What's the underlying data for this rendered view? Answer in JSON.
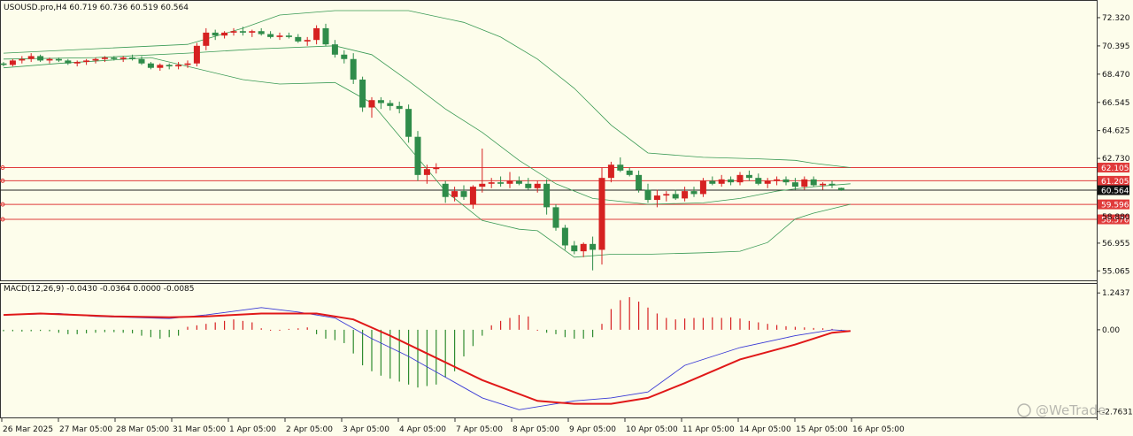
{
  "header": {
    "symbol_info": "USOUSD.pro,H4  60.719 60.736 60.519 60.564",
    "indicator_info": "MACD(12,26,9) -0.0430 -0.0364 0.0000 -0.0085"
  },
  "watermark": "@WeTrade",
  "colors": {
    "background": "#fdfdeb",
    "bull": "#d62121",
    "bear": "#2f8c4a",
    "bands": "#3a9a55",
    "hline": "#e03a3a",
    "signal": "#e01818",
    "macd_line": "#3a3ad6",
    "hist_up": "#d62121",
    "hist_down": "#2f8c2f"
  },
  "price_axis_labels": [
    "72.320",
    "70.395",
    "68.470",
    "66.545",
    "64.625",
    "62.730",
    "61.205",
    "59.596",
    "58.576",
    "56.955",
    "55.065"
  ],
  "macd_axis_labels": [
    "1.2437",
    "0.00",
    "-2.7631"
  ],
  "markers": [
    {
      "label": "62.105",
      "value": 62.105,
      "style": "red"
    },
    {
      "label": "61.205",
      "value": 61.205,
      "style": "red"
    },
    {
      "label": "60.564",
      "value": 60.564,
      "style": "current"
    },
    {
      "label": "59.596",
      "value": 59.596,
      "style": "red"
    },
    {
      "label": "58.576",
      "value": 58.576,
      "style": "red"
    },
    {
      "label": "58.880",
      "value": 58.88,
      "style": "plain"
    }
  ],
  "time_labels": [
    "26 Mar 2025",
    "27 Mar 05:00",
    "28 Mar 05:00",
    "31 Mar 05:00",
    "1 Apr 05:00",
    "2 Apr 05:00",
    "3 Apr 05:00",
    "4 Apr 05:00",
    "7 Apr 05:00",
    "8 Apr 05:00",
    "9 Apr 05:00",
    "10 Apr 05:00",
    "11 Apr 05:00",
    "14 Apr 05:00",
    "15 Apr 05:00",
    "16 Apr 05:00"
  ],
  "chart_data": {
    "type": "candlestick",
    "symbol": "USOUSD.pro",
    "timeframe": "H4",
    "ylim": [
      54.6,
      72.8
    ],
    "macd_ylim": [
      -2.9,
      1.4
    ],
    "candles": [
      [
        69.2,
        69.3,
        69.0,
        69.1
      ],
      [
        69.1,
        69.5,
        69.0,
        69.4
      ],
      [
        69.4,
        69.7,
        69.2,
        69.5
      ],
      [
        69.5,
        69.9,
        69.3,
        69.7
      ],
      [
        69.7,
        69.8,
        69.3,
        69.4
      ],
      [
        69.4,
        69.6,
        69.2,
        69.5
      ],
      [
        69.5,
        69.6,
        69.3,
        69.4
      ],
      [
        69.4,
        69.5,
        69.1,
        69.2
      ],
      [
        69.2,
        69.4,
        69.0,
        69.3
      ],
      [
        69.3,
        69.5,
        69.1,
        69.4
      ],
      [
        69.4,
        69.6,
        69.2,
        69.5
      ],
      [
        69.5,
        69.7,
        69.3,
        69.6
      ],
      [
        69.6,
        69.7,
        69.4,
        69.5
      ],
      [
        69.5,
        69.7,
        69.3,
        69.6
      ],
      [
        69.6,
        69.8,
        69.4,
        69.5
      ],
      [
        69.5,
        69.7,
        69.1,
        69.2
      ],
      [
        69.2,
        69.3,
        68.8,
        68.9
      ],
      [
        68.9,
        69.2,
        68.7,
        69.1
      ],
      [
        69.1,
        69.2,
        68.8,
        69.0
      ],
      [
        69.0,
        69.3,
        68.8,
        69.1
      ],
      [
        69.1,
        69.4,
        68.9,
        69.2
      ],
      [
        69.2,
        70.6,
        69.0,
        70.4
      ],
      [
        70.4,
        71.6,
        70.1,
        71.3
      ],
      [
        71.3,
        71.5,
        70.8,
        71.1
      ],
      [
        71.1,
        71.4,
        70.9,
        71.3
      ],
      [
        71.3,
        71.6,
        71.1,
        71.4
      ],
      [
        71.4,
        71.7,
        71.1,
        71.3
      ],
      [
        71.3,
        71.5,
        71.0,
        71.4
      ],
      [
        71.4,
        71.6,
        71.1,
        71.2
      ],
      [
        71.2,
        71.4,
        70.9,
        71.0
      ],
      [
        71.0,
        71.3,
        70.8,
        71.1
      ],
      [
        71.1,
        71.3,
        70.9,
        71.0
      ],
      [
        71.0,
        71.2,
        70.6,
        70.7
      ],
      [
        70.7,
        71.0,
        70.4,
        70.8
      ],
      [
        70.8,
        71.8,
        70.5,
        71.6
      ],
      [
        71.6,
        71.9,
        70.4,
        70.5
      ],
      [
        70.5,
        70.8,
        69.6,
        69.8
      ],
      [
        69.8,
        70.1,
        69.2,
        69.5
      ],
      [
        69.5,
        69.9,
        67.8,
        68.1
      ],
      [
        68.1,
        68.3,
        65.9,
        66.2
      ],
      [
        66.2,
        66.9,
        65.5,
        66.7
      ],
      [
        66.7,
        66.9,
        66.1,
        66.5
      ],
      [
        66.5,
        66.7,
        66.0,
        66.3
      ],
      [
        66.3,
        66.6,
        65.8,
        66.1
      ],
      [
        66.1,
        66.4,
        63.8,
        64.2
      ],
      [
        64.2,
        64.6,
        61.2,
        61.6
      ],
      [
        61.6,
        62.3,
        61.0,
        62.0
      ],
      [
        62.0,
        62.4,
        61.7,
        62.1
      ],
      [
        61.0,
        61.2,
        59.7,
        60.1
      ],
      [
        60.1,
        60.8,
        59.8,
        60.5
      ],
      [
        60.5,
        60.9,
        59.9,
        60.1
      ],
      [
        59.6,
        60.9,
        59.3,
        60.8
      ],
      [
        60.8,
        63.4,
        60.4,
        61.0
      ],
      [
        61.0,
        61.4,
        60.7,
        61.1
      ],
      [
        61.1,
        61.5,
        60.8,
        61.0
      ],
      [
        61.0,
        61.8,
        60.7,
        61.2
      ],
      [
        61.2,
        61.5,
        60.9,
        61.0
      ],
      [
        61.0,
        61.4,
        60.6,
        60.7
      ],
      [
        60.7,
        61.2,
        60.4,
        61.0
      ],
      [
        61.0,
        61.3,
        58.9,
        59.4
      ],
      [
        59.4,
        59.6,
        57.8,
        58.0
      ],
      [
        58.0,
        58.2,
        56.5,
        56.8
      ],
      [
        56.8,
        57.1,
        56.2,
        56.4
      ],
      [
        56.4,
        57.0,
        56.0,
        56.9
      ],
      [
        56.9,
        57.4,
        55.1,
        56.5
      ],
      [
        56.5,
        62.1,
        55.5,
        61.4
      ],
      [
        61.4,
        62.5,
        61.1,
        62.3
      ],
      [
        62.3,
        62.8,
        61.8,
        61.9
      ],
      [
        61.9,
        62.1,
        61.5,
        61.6
      ],
      [
        61.6,
        61.9,
        60.4,
        60.6
      ],
      [
        60.6,
        61.0,
        59.7,
        59.9
      ],
      [
        59.9,
        60.6,
        59.4,
        60.2
      ],
      [
        60.2,
        60.5,
        59.8,
        60.3
      ],
      [
        60.3,
        60.6,
        59.9,
        60.0
      ],
      [
        60.0,
        60.8,
        59.8,
        60.5
      ],
      [
        60.5,
        60.8,
        60.1,
        60.3
      ],
      [
        60.3,
        61.4,
        60.1,
        61.2
      ],
      [
        61.2,
        61.5,
        60.9,
        61.0
      ],
      [
        61.0,
        61.6,
        60.8,
        61.3
      ],
      [
        61.3,
        61.5,
        60.9,
        61.1
      ],
      [
        61.1,
        61.8,
        60.9,
        61.6
      ],
      [
        61.6,
        61.9,
        61.2,
        61.4
      ],
      [
        61.4,
        61.7,
        60.9,
        61.0
      ],
      [
        61.0,
        61.4,
        60.7,
        61.2
      ],
      [
        61.2,
        61.5,
        60.9,
        61.3
      ],
      [
        61.3,
        61.5,
        60.9,
        61.1
      ],
      [
        61.1,
        61.4,
        60.6,
        60.8
      ],
      [
        60.8,
        61.5,
        60.6,
        61.3
      ],
      [
        61.3,
        61.5,
        60.8,
        60.9
      ],
      [
        60.9,
        61.1,
        60.6,
        61.0
      ],
      [
        61.0,
        61.2,
        60.7,
        60.9
      ],
      [
        60.719,
        60.736,
        60.519,
        60.564
      ]
    ],
    "upper_band": [
      [
        0,
        69.9
      ],
      [
        10,
        70.2
      ],
      [
        20,
        70.5
      ],
      [
        26,
        71.6
      ],
      [
        30,
        72.5
      ],
      [
        36,
        72.8
      ],
      [
        44,
        72.8
      ],
      [
        50,
        72.0
      ],
      [
        54,
        71.0
      ],
      [
        58,
        69.5
      ],
      [
        62,
        67.5
      ],
      [
        66,
        65.0
      ],
      [
        70,
        63.1
      ],
      [
        76,
        62.8
      ],
      [
        82,
        62.7
      ],
      [
        86,
        62.6
      ],
      [
        88,
        62.4
      ],
      [
        92,
        62.1
      ]
    ],
    "middle_band": [
      [
        0,
        69.5
      ],
      [
        10,
        69.6
      ],
      [
        20,
        69.9
      ],
      [
        28,
        70.2
      ],
      [
        36,
        70.4
      ],
      [
        40,
        69.8
      ],
      [
        44,
        68.0
      ],
      [
        48,
        66.1
      ],
      [
        52,
        64.5
      ],
      [
        56,
        62.6
      ],
      [
        60,
        61.0
      ],
      [
        64,
        60.0
      ],
      [
        70,
        59.6
      ],
      [
        76,
        59.7
      ],
      [
        80,
        60.0
      ],
      [
        84,
        60.5
      ],
      [
        88,
        60.8
      ],
      [
        92,
        61.0
      ]
    ],
    "lower_band": [
      [
        0,
        68.9
      ],
      [
        6,
        69.2
      ],
      [
        16,
        69.6
      ],
      [
        26,
        68.1
      ],
      [
        30,
        67.8
      ],
      [
        36,
        67.9
      ],
      [
        40,
        66.5
      ],
      [
        44,
        63.5
      ],
      [
        48,
        60.5
      ],
      [
        52,
        58.5
      ],
      [
        56,
        57.9
      ],
      [
        58,
        57.8
      ],
      [
        62,
        56.0
      ],
      [
        66,
        56.2
      ],
      [
        70,
        56.2
      ],
      [
        76,
        56.3
      ],
      [
        80,
        56.4
      ],
      [
        83,
        57.0
      ],
      [
        86,
        58.6
      ],
      [
        88,
        59.0
      ],
      [
        92,
        59.6
      ]
    ],
    "macd_line": [
      [
        0,
        0.5
      ],
      [
        6,
        0.55
      ],
      [
        10,
        0.45
      ],
      [
        18,
        0.38
      ],
      [
        22,
        0.5
      ],
      [
        28,
        0.75
      ],
      [
        32,
        0.6
      ],
      [
        36,
        0.4
      ],
      [
        40,
        -0.3
      ],
      [
        44,
        -0.9
      ],
      [
        48,
        -1.6
      ],
      [
        52,
        -2.3
      ],
      [
        56,
        -2.7
      ],
      [
        62,
        -2.4
      ],
      [
        66,
        -2.3
      ],
      [
        70,
        -2.1
      ],
      [
        74,
        -1.2
      ],
      [
        80,
        -0.6
      ],
      [
        86,
        -0.2
      ],
      [
        90,
        0.0
      ],
      [
        92,
        -0.04
      ]
    ],
    "signal_line": [
      [
        0,
        0.5
      ],
      [
        4,
        0.55
      ],
      [
        12,
        0.45
      ],
      [
        18,
        0.42
      ],
      [
        22,
        0.45
      ],
      [
        28,
        0.55
      ],
      [
        34,
        0.55
      ],
      [
        38,
        0.35
      ],
      [
        42,
        -0.2
      ],
      [
        46,
        -0.8
      ],
      [
        52,
        -1.7
      ],
      [
        58,
        -2.4
      ],
      [
        62,
        -2.5
      ],
      [
        66,
        -2.5
      ],
      [
        70,
        -2.3
      ],
      [
        74,
        -1.8
      ],
      [
        80,
        -1.0
      ],
      [
        86,
        -0.5
      ],
      [
        90,
        -0.1
      ],
      [
        92,
        -0.04
      ]
    ],
    "histogram": [
      -0.05,
      -0.05,
      -0.06,
      -0.05,
      -0.04,
      -0.05,
      -0.1,
      -0.15,
      -0.15,
      -0.12,
      -0.1,
      -0.08,
      -0.08,
      -0.1,
      -0.12,
      -0.2,
      -0.25,
      -0.3,
      -0.25,
      -0.2,
      0.1,
      0.15,
      0.2,
      0.25,
      0.3,
      0.35,
      0.3,
      0.25,
      0.05,
      0.02,
      0.02,
      0.03,
      0.05,
      0.08,
      -0.15,
      -0.3,
      -0.35,
      -0.45,
      -0.8,
      -1.2,
      -1.4,
      -1.55,
      -1.65,
      -1.75,
      -1.85,
      -1.95,
      -1.9,
      -1.85,
      -1.6,
      -1.4,
      -0.9,
      -0.55,
      -0.2,
      0.15,
      0.3,
      0.4,
      0.5,
      0.45,
      0.0,
      -0.1,
      -0.15,
      -0.25,
      -0.3,
      -0.3,
      -0.25,
      0.2,
      0.7,
      1.0,
      1.1,
      0.95,
      0.75,
      0.55,
      0.4,
      0.35,
      0.38,
      0.4,
      0.4,
      0.42,
      0.4,
      0.42,
      0.38,
      0.3,
      0.25,
      0.2,
      0.16,
      0.12,
      0.1,
      0.08,
      0.06,
      0.05,
      0.03,
      -0.0085
    ]
  }
}
